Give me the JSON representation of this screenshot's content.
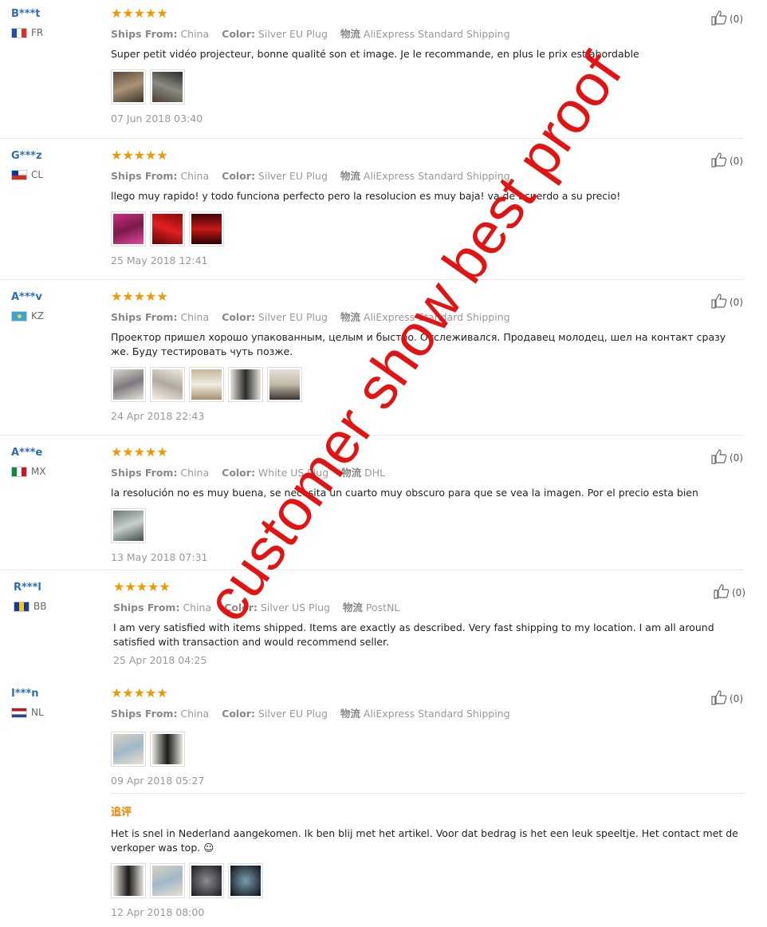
{
  "labels": {
    "ships_from": "Ships From:",
    "color": "Color:",
    "logistics": "物流",
    "followup": "追评"
  },
  "reviews": [
    {
      "name": "B***t",
      "country": "FR",
      "stars": "★★★★★",
      "ships_from": "China",
      "color": "Silver EU Plug",
      "logistics": "AliExpress Standard Shipping",
      "text": "Super petit vidéo projecteur, bonne qualité son et image. Je le recommande, en plus le prix est abordable",
      "date": "07 Jun 2018 03:40",
      "likes": "(0)"
    },
    {
      "name": "G***z",
      "country": "CL",
      "stars": "★★★★★",
      "ships_from": "China",
      "color": "Silver EU Plug",
      "logistics": "AliExpress Standard Shipping",
      "text": "llego muy rapido! y todo funciona perfecto pero la resolucion es muy baja! va de acuerdo a su precio!",
      "date": "25 May 2018 12:41",
      "likes": "(0)"
    },
    {
      "name": "A***v",
      "country": "KZ",
      "stars": "★★★★★",
      "ships_from": "China",
      "color": "Silver EU Plug",
      "logistics": "AliExpress Standard Shipping",
      "text": "Проектор пришел хорошо упакованным, целым и быстро. Отслеживался. Продавец молодец, шел на контакт сразу же. Буду тестировать чуть позже.",
      "date": "24 Apr 2018 22:43",
      "likes": "(0)"
    },
    {
      "name": "A***e",
      "country": "MX",
      "stars": "★★★★★",
      "ships_from": "China",
      "color": "White US Plug",
      "logistics": "DHL",
      "text": "la resolución no es muy buena, se necesita un cuarto muy obscuro para que se vea la imagen. Por el precio esta bien",
      "date": "13 May 2018 07:31",
      "likes": "(0)"
    },
    {
      "name": "R***l",
      "country": "BB",
      "stars": "★★★★★",
      "ships_from": "China",
      "color": "Silver US Plug",
      "logistics": "PostNL",
      "text": "I am very satisfied with items shipped. Items are exactly as described. Very fast shipping to my location. I am all around satisfied with transaction and would recommend seller.",
      "date": "25 Apr 2018 04:25",
      "likes": "(0)"
    },
    {
      "name": "I***n",
      "country": "NL",
      "stars": "★★★★★",
      "ships_from": "China",
      "color": "Silver EU Plug",
      "logistics": "AliExpress Standard Shipping",
      "date": "09 Apr 2018 05:27",
      "likes": "(0)",
      "followup_text": "Het is snel in Nederland aangekomen. Ik ben blij met het artikel. Voor dat bedrag is het een leuk speeltje. Het contact met de verkoper was top. ☺",
      "followup_date": "12 Apr 2018 08:00"
    }
  ],
  "watermark": "customer show best proof",
  "colors": {
    "name": "#2a6fb8",
    "stars": "#f09800",
    "followup": "#f08200",
    "watermark": "#e11313"
  }
}
